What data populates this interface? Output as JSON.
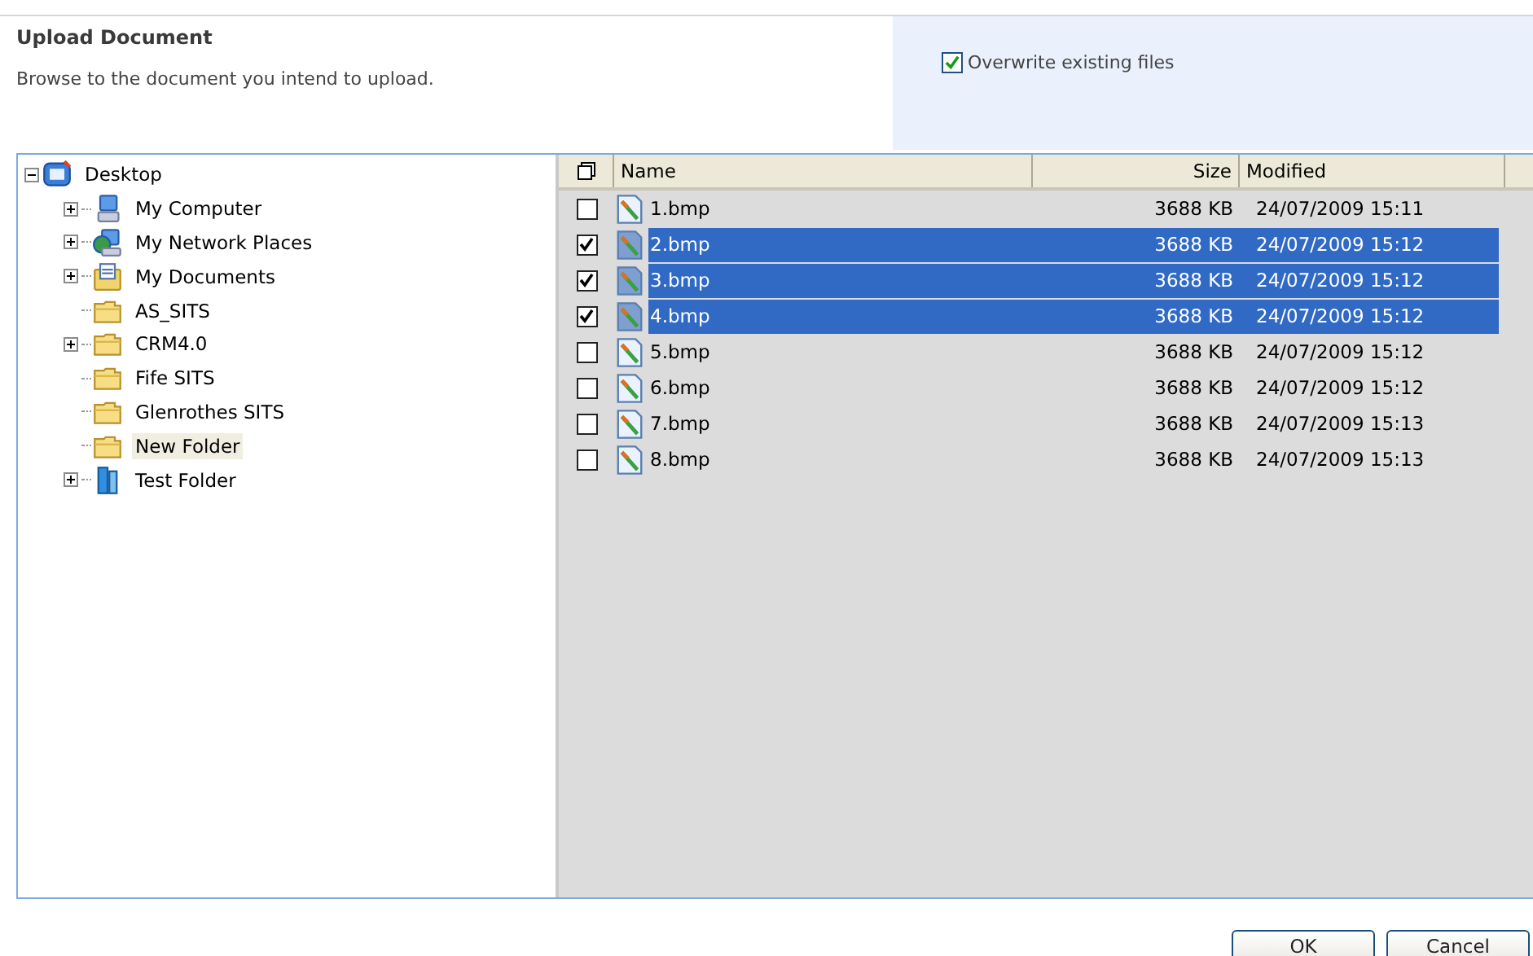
{
  "header": {
    "title": "Upload Document",
    "description": "Browse to the document you intend to upload.",
    "overwrite": {
      "label": "Overwrite existing files",
      "checked": true
    }
  },
  "tree": {
    "label": "Desktop",
    "kind": "desktop",
    "expanded": true,
    "selected": false,
    "children": [
      {
        "label": "My Computer",
        "kind": "computer",
        "expandable": true,
        "selected": false
      },
      {
        "label": "My Network Places",
        "kind": "network",
        "expandable": true,
        "selected": false
      },
      {
        "label": "My Documents",
        "kind": "documents",
        "expandable": true,
        "selected": false
      },
      {
        "label": "AS_SITS",
        "kind": "folder",
        "expandable": false,
        "selected": false
      },
      {
        "label": "CRM4.0",
        "kind": "folder",
        "expandable": true,
        "selected": false
      },
      {
        "label": "Fife SITS",
        "kind": "folder",
        "expandable": false,
        "selected": false
      },
      {
        "label": "Glenrothes SITS",
        "kind": "folder",
        "expandable": false,
        "selected": false
      },
      {
        "label": "New Folder",
        "kind": "folder",
        "expandable": false,
        "selected": true
      },
      {
        "label": "Test Folder",
        "kind": "special",
        "expandable": true,
        "selected": false
      }
    ]
  },
  "files": {
    "columns": [
      "Name",
      "Size",
      "Modified"
    ],
    "rows": [
      {
        "name": "1.bmp",
        "size": "3688 KB",
        "modified": "24/07/2009 15:11",
        "checked": false,
        "selected": false
      },
      {
        "name": "2.bmp",
        "size": "3688 KB",
        "modified": "24/07/2009 15:12",
        "checked": true,
        "selected": true
      },
      {
        "name": "3.bmp",
        "size": "3688 KB",
        "modified": "24/07/2009 15:12",
        "checked": true,
        "selected": true
      },
      {
        "name": "4.bmp",
        "size": "3688 KB",
        "modified": "24/07/2009 15:12",
        "checked": true,
        "selected": true
      },
      {
        "name": "5.bmp",
        "size": "3688 KB",
        "modified": "24/07/2009 15:12",
        "checked": false,
        "selected": false
      },
      {
        "name": "6.bmp",
        "size": "3688 KB",
        "modified": "24/07/2009 15:12",
        "checked": false,
        "selected": false
      },
      {
        "name": "7.bmp",
        "size": "3688 KB",
        "modified": "24/07/2009 15:13",
        "checked": false,
        "selected": false
      },
      {
        "name": "8.bmp",
        "size": "3688 KB",
        "modified": "24/07/2009 15:13",
        "checked": false,
        "selected": false
      }
    ]
  },
  "buttons": [
    "OK",
    "Cancel"
  ]
}
